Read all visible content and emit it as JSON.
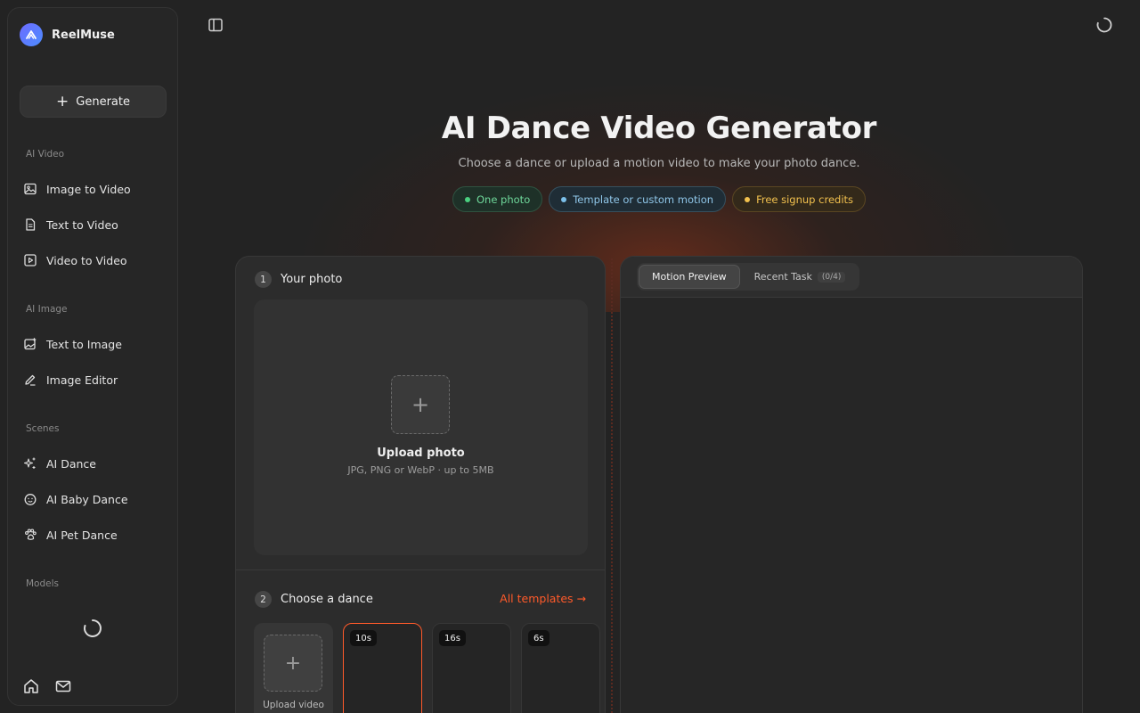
{
  "brand": {
    "name": "ReelMuse",
    "logo_icon": "logo-peak-icon",
    "accent": "#6d6bff"
  },
  "sidebar": {
    "generate_label": "Generate",
    "sections": [
      {
        "label": "AI Video",
        "items": [
          {
            "label": "Image to Video",
            "icon": "image-icon"
          },
          {
            "label": "Text to Video",
            "icon": "document-icon"
          },
          {
            "label": "Video to Video",
            "icon": "play-square-icon"
          }
        ]
      },
      {
        "label": "AI Image",
        "items": [
          {
            "label": "Text to Image",
            "icon": "image-plus-icon"
          },
          {
            "label": "Image Editor",
            "icon": "pencil-icon"
          }
        ]
      },
      {
        "label": "Scenes",
        "items": [
          {
            "label": "AI Dance",
            "icon": "sparkles-icon"
          },
          {
            "label": "AI Baby Dance",
            "icon": "smile-icon"
          },
          {
            "label": "AI Pet Dance",
            "icon": "paw-icon"
          }
        ]
      },
      {
        "label": "Models",
        "items": []
      }
    ]
  },
  "hero": {
    "title": "AI Dance Video Generator",
    "subtitle": "Choose a dance or upload a motion video to make your photo dance.",
    "chips": [
      {
        "label": "One photo",
        "color": "#4ad080"
      },
      {
        "label": "Template or custom motion",
        "color": "#7cc0ea"
      },
      {
        "label": "Free signup credits",
        "color": "#f2c14e"
      }
    ]
  },
  "step1": {
    "number": "1",
    "title": "Your photo",
    "upload_title": "Upload photo",
    "upload_hint": "JPG, PNG or WebP · up to 5MB"
  },
  "step2": {
    "number": "2",
    "title": "Choose a dance",
    "all_templates": "All templates →",
    "upload_video_label": "Upload video",
    "templates": [
      {
        "duration": "10s",
        "selected": true
      },
      {
        "duration": "16s",
        "selected": false
      },
      {
        "duration": "6s",
        "selected": false
      }
    ]
  },
  "preview": {
    "tabs": [
      {
        "label": "Motion Preview",
        "active": true
      },
      {
        "label": "Recent Task",
        "count": "(0/4)",
        "active": false
      }
    ]
  },
  "colors": {
    "accent_orange": "#ff5a2a",
    "background": "#232323"
  }
}
